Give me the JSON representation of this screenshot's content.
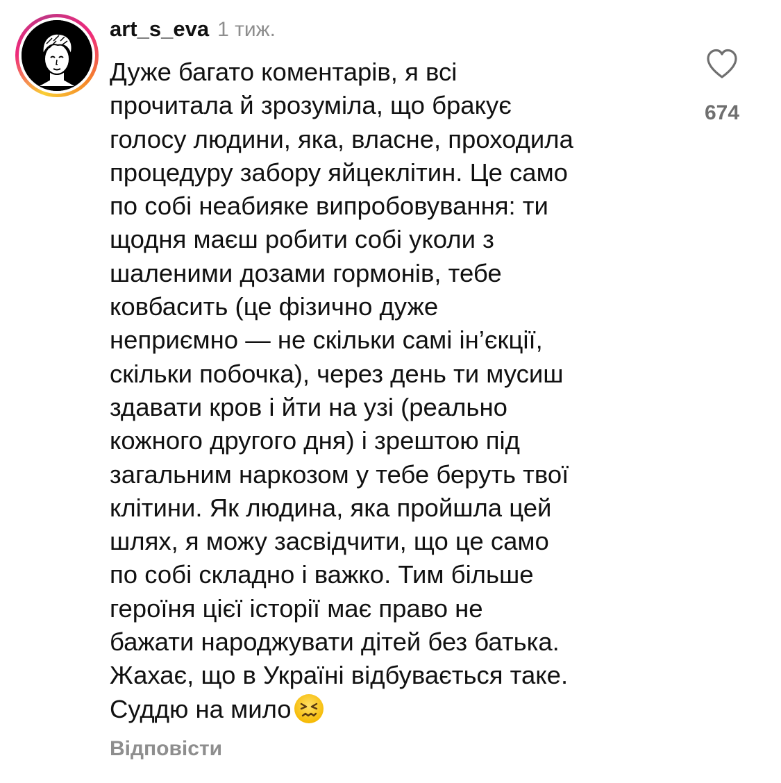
{
  "comment": {
    "username": "art_s_eva",
    "timestamp": "1 тиж.",
    "text_lines": [
      "Дуже багато коментарів, я всі",
      "прочитала й зрозуміла, що бракує",
      "голосу людини, яка, власне, проходила",
      "процедуру забору яйцеклітин. Це само",
      "по собі неабияке випробовування: ти",
      "щодня маєш робити собі уколи з",
      "шаленими дозами гормонів, тебе",
      "ковбасить (це фізично дуже",
      "неприємно — не скільки самі ін’єкції,",
      "скільки побочка), через день ти мусиш",
      "здавати кров і йти на узі (реально",
      "кожного другого дня) і зрештою під",
      "загальним наркозом у тебе беруть твої",
      "клітини. Як людина, яка пройшла цей",
      "шлях, я можу засвідчити, що це само",
      "по собі складно і важко. Тим більше",
      "героїня цієї історії має право не",
      "бажати народжувати дітей без батька.",
      "Жахає, що в Україні відбувається таке.",
      "Суддю на мило"
    ],
    "emoji": "confounded-face",
    "like_count": "674",
    "reply_label": "Відповісти"
  },
  "icons": {
    "like": "heart-outline-icon",
    "avatar": "profile-avatar"
  },
  "colors": {
    "text": "#111111",
    "secondary": "#8e8e8e",
    "like_count": "#6f6f6f",
    "story_ring": [
      "#f9ce34",
      "#ee2a7b",
      "#c13584",
      "#f58529"
    ]
  }
}
